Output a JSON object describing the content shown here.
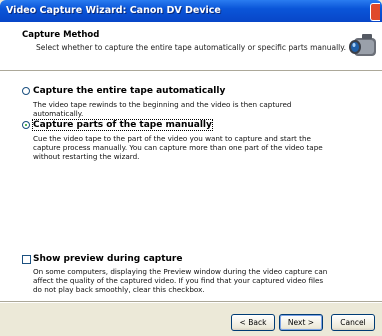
{
  "window": {
    "title": "Video Capture Wizard: Canon DV Device"
  },
  "header": {
    "title": "Capture Method",
    "subtitle": "Select whether to capture the entire tape automatically or specific parts manually.",
    "icon": "camcorder-icon"
  },
  "options": [
    {
      "label": "Capture the entire tape automatically",
      "description": "The video tape rewinds to the beginning and the video is then captured automatically.",
      "selected": false
    },
    {
      "label": "Capture parts of the tape manually",
      "description": "Cue the video tape to the part of the video you want to capture and start the capture process manually. You can capture more than one part of the video tape without restarting the wizard.",
      "selected": true
    }
  ],
  "preview": {
    "label": "Show preview during capture",
    "description": "On some computers, displaying the Preview window during the video capture can affect the quality of the captured video. If you find that your captured video files do not play back smoothly, clear this checkbox.",
    "checked": false
  },
  "buttons": {
    "back": "< Back",
    "next": "Next >",
    "cancel": "Cancel"
  },
  "colors": {
    "titlebar": "#0a55d8",
    "dialog_bg": "#ece9d8",
    "radio_dot": "#21a121"
  }
}
